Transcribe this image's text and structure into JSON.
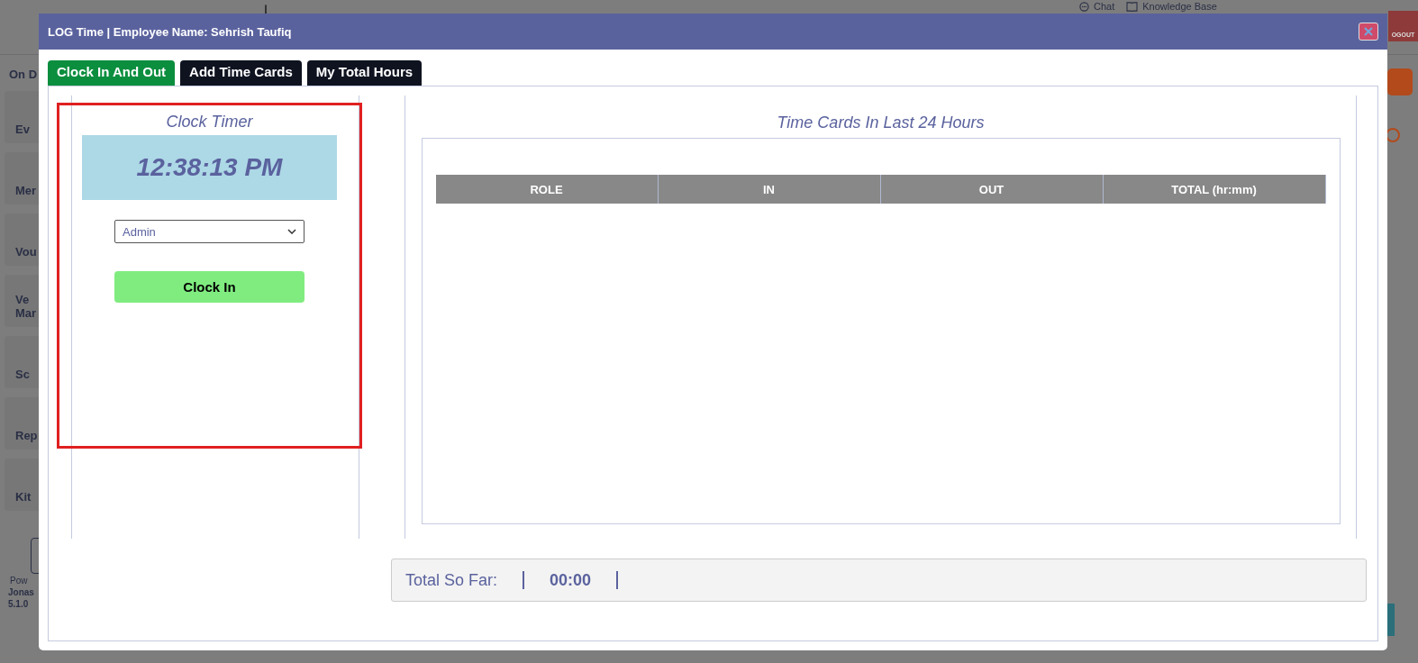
{
  "background": {
    "header_links": [
      {
        "kind": "chat",
        "label": "Chat"
      },
      {
        "kind": "book",
        "label": "Knowledge Base"
      }
    ],
    "logout": "OGOUT",
    "sidebar_top": "On D",
    "sidebar_items": [
      {
        "label": "Ev"
      },
      {
        "label": "Mer"
      },
      {
        "label": "Vou"
      },
      {
        "label": "Ve Mar"
      },
      {
        "label": "Sc"
      },
      {
        "label": "Rep"
      },
      {
        "label": "Kit"
      }
    ],
    "footer": [
      "Pow",
      "Jonas",
      "5.1.0"
    ]
  },
  "window": {
    "title": "LOG Time | Employee Name: Sehrish Taufiq"
  },
  "tabs": [
    {
      "label": "Clock In And Out",
      "selected": true
    },
    {
      "label": "Add Time Cards",
      "selected": false
    },
    {
      "label": "My Total Hours",
      "selected": false
    }
  ],
  "clock": {
    "title": "Clock Timer",
    "time": "12:38:13 PM",
    "role": "Admin",
    "button": "Clock In",
    "highlighted": true
  },
  "time_cards": {
    "title": "Time Cards In Last 24 Hours",
    "columns": [
      "ROLE",
      "IN",
      "OUT",
      "TOTAL (hr:mm)"
    ]
  },
  "total": {
    "label": "Total So Far:",
    "value": "00:00"
  }
}
